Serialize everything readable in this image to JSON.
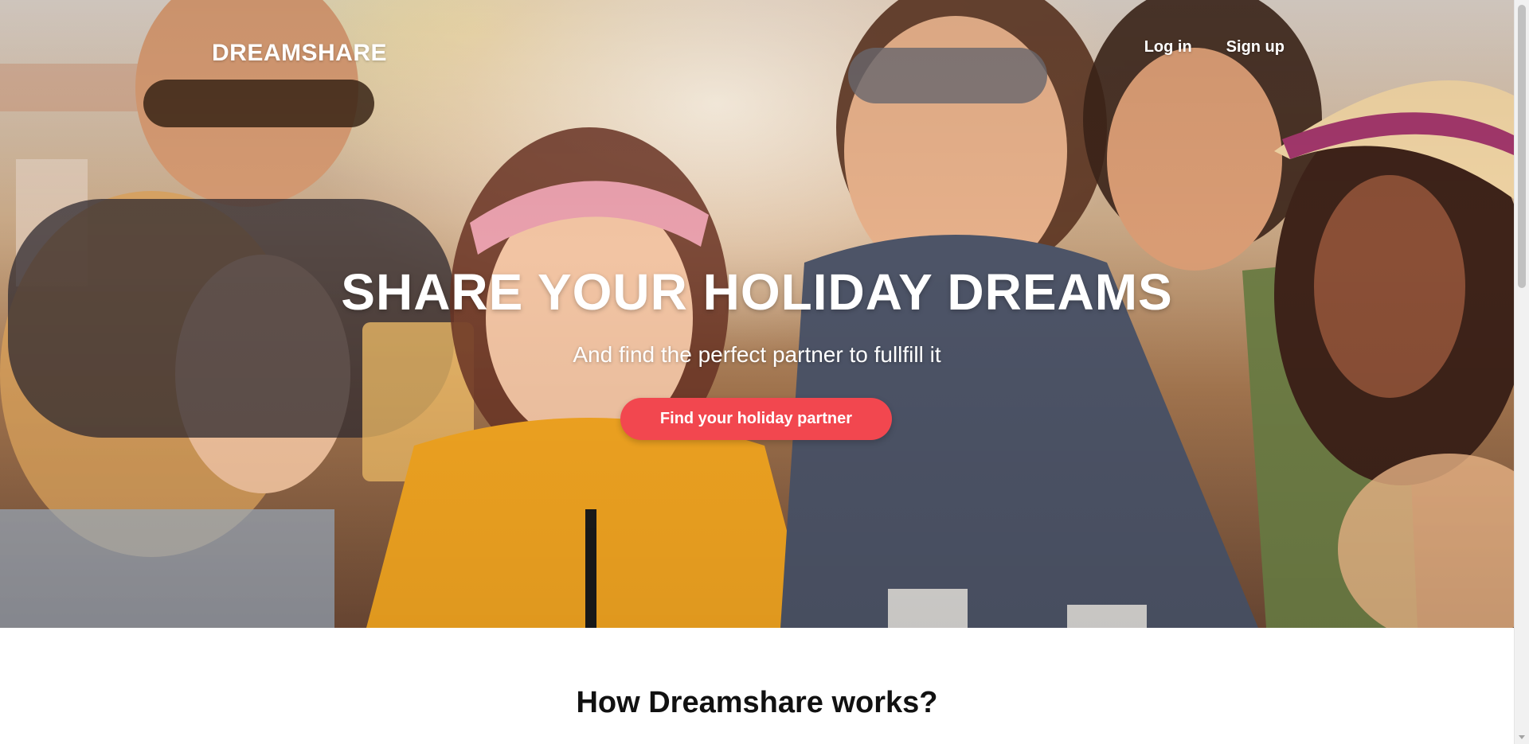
{
  "header": {
    "logo": "DREAMSHARE",
    "nav": [
      {
        "label": "Log in"
      },
      {
        "label": "Sign up"
      }
    ]
  },
  "hero": {
    "title": "SHARE YOUR HOLIDAY DREAMS",
    "subtitle": "And find the perfect partner to fullfill it",
    "cta_label": "Find your holiday partner",
    "background_image": "group of smiling friends having drinks"
  },
  "section": {
    "title": "How Dreamshare works?"
  },
  "colors": {
    "accent": "#f2474f",
    "text_dark": "#111111",
    "text_light": "#ffffff"
  }
}
